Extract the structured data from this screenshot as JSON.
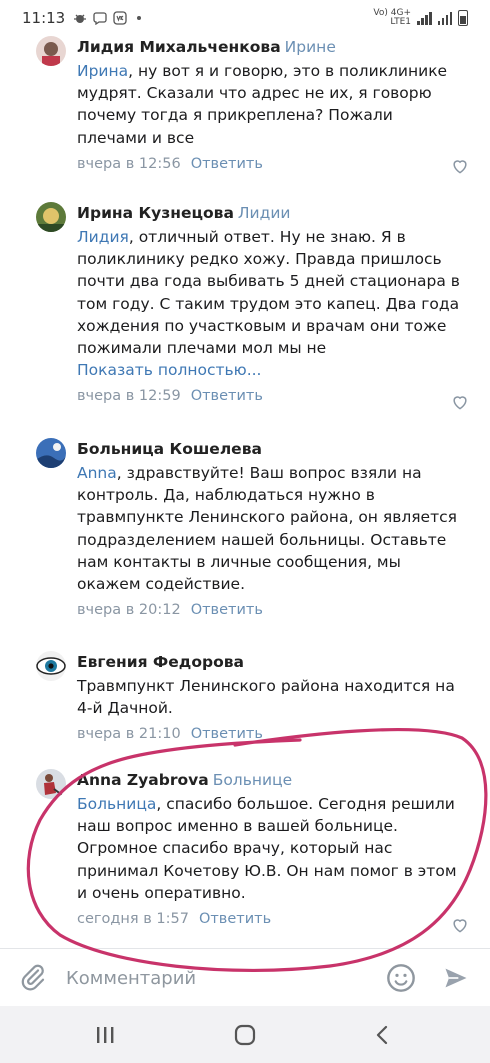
{
  "status_bar": {
    "time": "11:13",
    "network_label": "Vo) 4G+\nLTE1",
    "network_line1": "Vo) 4G+",
    "network_line2": "LTE1"
  },
  "comments": [
    {
      "author": "Лидия Михальченкова",
      "reply_to": "Ирине",
      "mention": "Ирина",
      "text": ", ну вот я и говорю, это в поликлинике мудрят. Сказали что адрес не их, я говорю почему тогда я прикреплена? Пожали плечами и все",
      "time": "вчера в 12:56",
      "reply_label": "Ответить",
      "avatar_color": "#7a5a4e",
      "show_more": ""
    },
    {
      "author": "Ирина Кузнецова",
      "reply_to": "Лидии",
      "mention": "Лидия",
      "text": ", отличный ответ. Ну не знаю. Я в поликлинику редко хожу. Правда пришлось почти два года выбивать 5 дней стационара в том году. С таким трудом это капец. Два года хождения по участковым и врачам они тоже пожимали плечами мол мы не",
      "time": "вчера в 12:59",
      "reply_label": "Ответить",
      "avatar_color": "#c9a83a",
      "show_more": "Показать полностью..."
    },
    {
      "author": "Больница Кошелева",
      "reply_to": "",
      "mention": "Anna",
      "text": ", здравствуйте! Ваш вопрос взяли на контроль. Да, наблюдаться нужно в травмпункте Ленинского района, он является подразделением нашей больницы. Оставьте нам контакты в личные сообщения, мы окажем содействие.",
      "time": "вчера в 20:12",
      "reply_label": "Ответить",
      "avatar_color": "#2f5a9a",
      "show_more": ""
    },
    {
      "author": "Евгения Федорова",
      "reply_to": "",
      "mention": "",
      "text": "Травмпункт Ленинского района находится на 4-й Дачной.",
      "time": "вчера в 21:10",
      "reply_label": "Ответить",
      "avatar_color": "#1f5f7a",
      "show_more": ""
    },
    {
      "author": "Anna Zyabrova",
      "reply_to": "Больнице",
      "mention": "Больница",
      "text": ", спасибо большое. Сегодня решили наш вопрос именно в вашей больнице. Огромное спасибо врачу, который нас принимал Кочетову Ю.В. Он нам помог в этом и очень оперативно.",
      "time": "сегодня в 1:57",
      "reply_label": "Ответить",
      "avatar_color": "#b0323a",
      "show_more": ""
    }
  ],
  "composer": {
    "placeholder": "Комментарий"
  },
  "icons": {
    "attach": "paperclip-icon",
    "emoji": "emoji-icon",
    "send": "send-icon",
    "like": "heart-icon",
    "nav_recent": "recent-apps-icon",
    "nav_home": "home-icon",
    "nav_back": "back-icon"
  },
  "colors": {
    "link": "#3f78b4",
    "meta": "#8a96a3",
    "annotation": "#c8336a"
  }
}
